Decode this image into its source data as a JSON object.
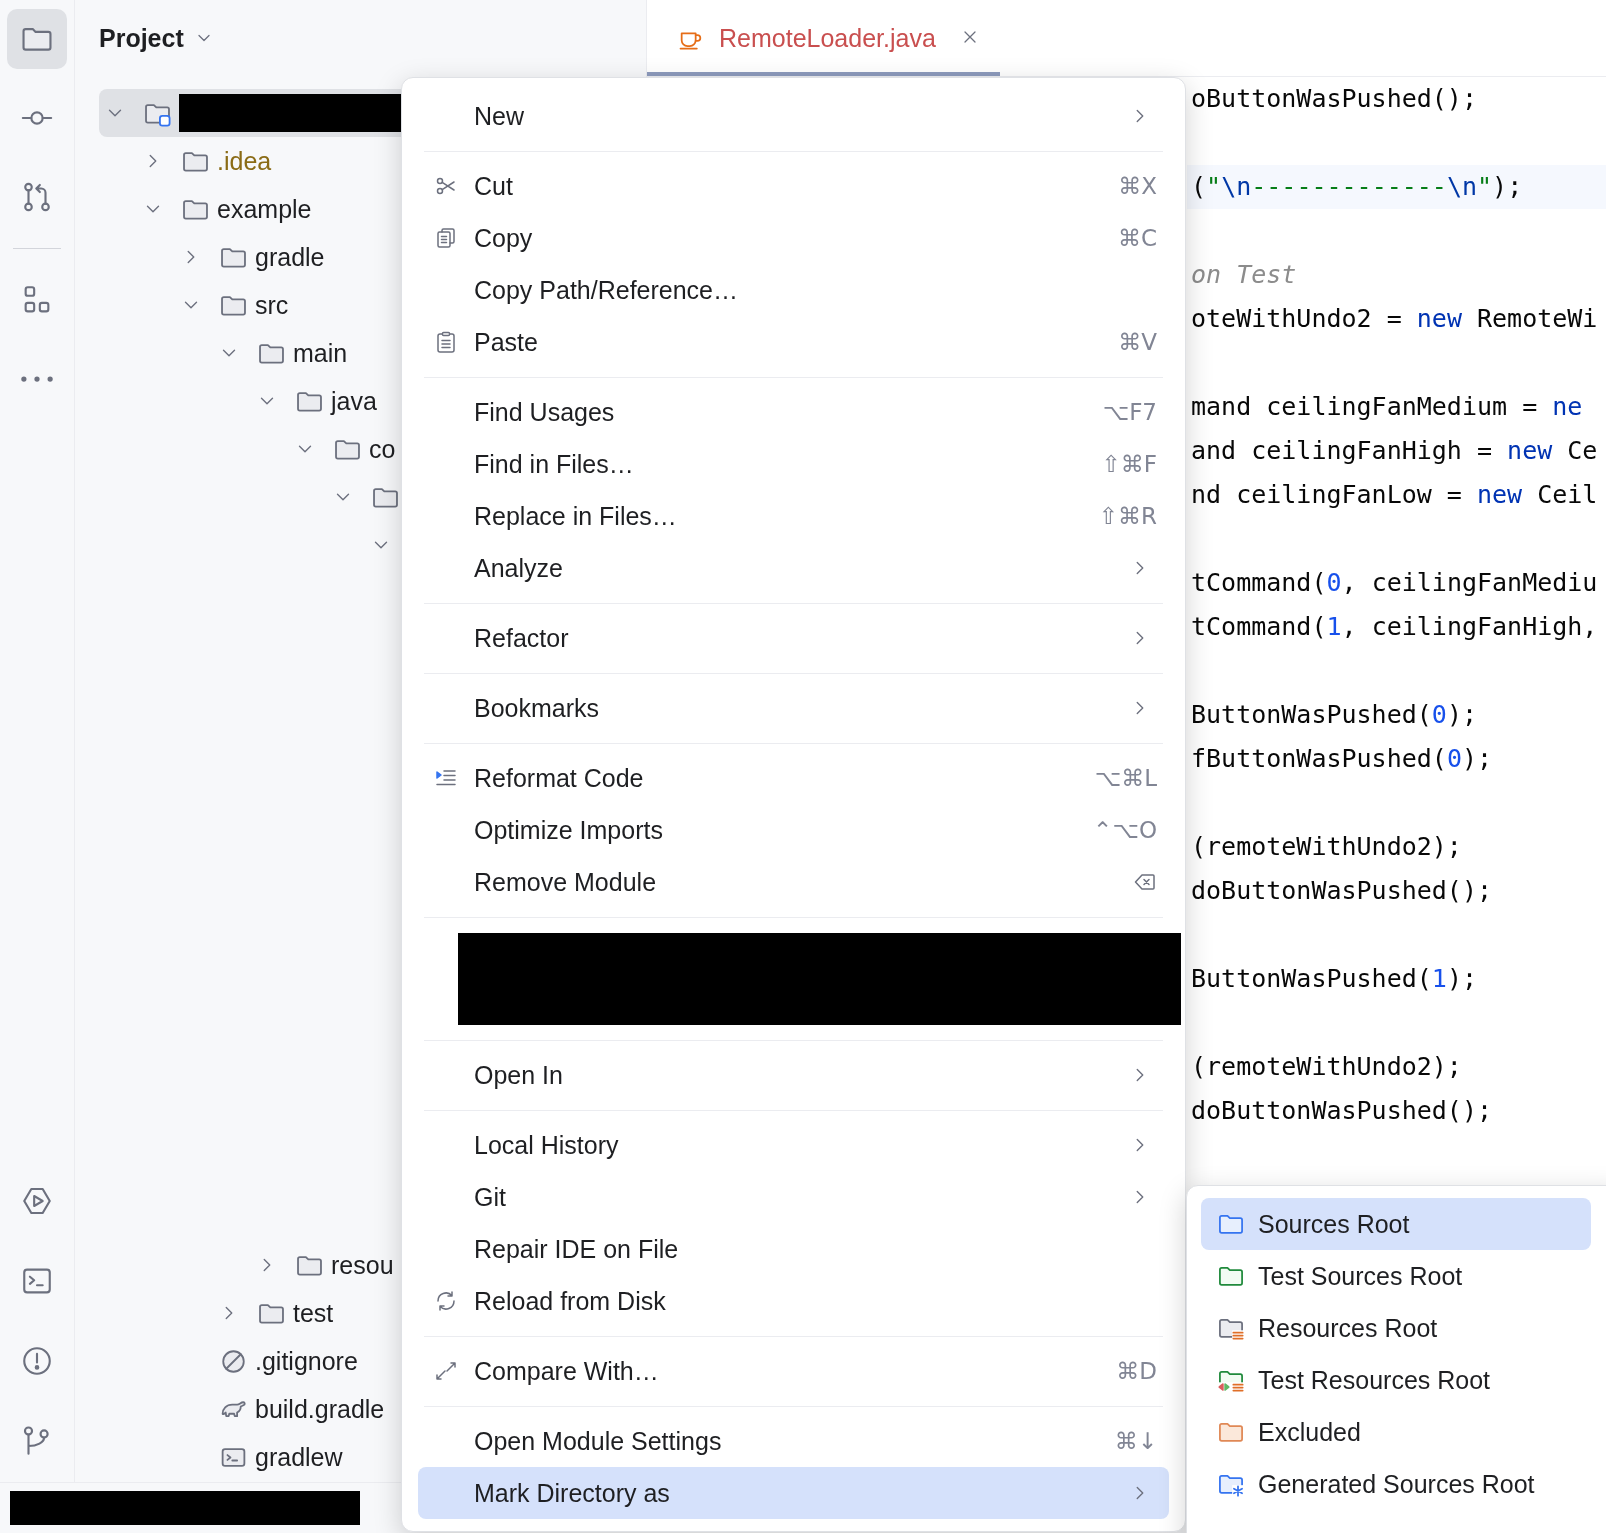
{
  "tool_strip": {
    "top": [
      {
        "kind": "folder",
        "selected": true
      },
      {
        "kind": "commit",
        "selected": false
      },
      {
        "kind": "pull_request",
        "selected": false
      },
      {
        "kind": "separator"
      },
      {
        "kind": "structure",
        "selected": false
      },
      {
        "kind": "more",
        "selected": false
      }
    ],
    "bottom": [
      {
        "kind": "run",
        "selected": false
      },
      {
        "kind": "terminal",
        "selected": false
      },
      {
        "kind": "problems",
        "selected": false
      },
      {
        "kind": "branch",
        "selected": false
      }
    ]
  },
  "project_panel": {
    "title": "Project",
    "tree": [
      {
        "redacted": true,
        "kind": "module",
        "expanded": true,
        "selected": true,
        "children": [
          {
            "label": ".idea",
            "kind": "folder",
            "expanded": false,
            "selected": false,
            "ignored": true
          },
          {
            "label": "example",
            "kind": "folder",
            "expanded": true,
            "selected": false,
            "ignored": false,
            "children": [
              {
                "label": "gradle",
                "kind": "folder",
                "expanded": false,
                "selected": false,
                "ignored": false
              },
              {
                "label": "src",
                "kind": "folder",
                "expanded": true,
                "selected": false,
                "ignored": false,
                "children": [
                  {
                    "label": "main",
                    "kind": "folder",
                    "expanded": true,
                    "selected": false,
                    "ignored": false,
                    "children": [
                      {
                        "label": "java",
                        "kind": "folder",
                        "expanded": true,
                        "selected": false,
                        "ignored": false,
                        "children": [
                          {
                            "label": "co",
                            "kind": "folder",
                            "expanded": true,
                            "selected": false,
                            "ignored": false,
                            "children": [
                              {
                                "kind": "folder",
                                "expanded": true,
                                "selected": false,
                                "children": [
                                  {
                                    "expanded": true,
                                    "selected": false
                                  }
                                ]
                              }
                            ]
                          }
                        ]
                      },
                      {
                        "label": "resou",
                        "kind": "folder",
                        "expanded": false,
                        "selected": false,
                        "ignored": false
                      }
                    ]
                  },
                  {
                    "label": "test",
                    "kind": "folder",
                    "expanded": false,
                    "selected": false,
                    "ignored": false
                  }
                ]
              },
              {
                "label": ".gitignore",
                "kind": "gitignore",
                "selected": false,
                "ignored": false
              },
              {
                "label": "build.gradle",
                "kind": "gradle",
                "selected": false,
                "ignored": false
              },
              {
                "label": "gradlew",
                "kind": "script",
                "selected": false,
                "ignored": false
              }
            ]
          }
        ]
      }
    ]
  },
  "editor": {
    "tab": {
      "label": "RemoteLoader.java",
      "selected": true,
      "error": true
    },
    "lines": [
      {
        "kind": "code",
        "current": false,
        "segments": [
          {
            "kind": "plain",
            "text": "oButtonWasPushed();"
          }
        ]
      },
      {
        "kind": "blank"
      },
      {
        "kind": "code",
        "current": true,
        "segments": [
          {
            "kind": "plain",
            "text": "("
          },
          {
            "kind": "string",
            "text": "\""
          },
          {
            "kind": "escape",
            "text": "\\n"
          },
          {
            "kind": "string",
            "text": "-------------"
          },
          {
            "kind": "escape",
            "text": "\\n"
          },
          {
            "kind": "string",
            "text": "\""
          },
          {
            "kind": "plain",
            "text": ");"
          }
        ]
      },
      {
        "kind": "blank"
      },
      {
        "kind": "code",
        "current": false,
        "segments": [
          {
            "kind": "comment",
            "text": "on Test"
          }
        ]
      },
      {
        "kind": "code",
        "current": false,
        "segments": [
          {
            "kind": "plain",
            "text": "oteWithUndo2 = "
          },
          {
            "kind": "keyword",
            "text": "new"
          },
          {
            "kind": "plain",
            "text": " RemoteWi"
          }
        ]
      },
      {
        "kind": "blank"
      },
      {
        "kind": "code",
        "current": false,
        "segments": [
          {
            "kind": "plain",
            "text": "mand ceilingFanMedium = "
          },
          {
            "kind": "keyword",
            "text": "ne"
          }
        ]
      },
      {
        "kind": "code",
        "current": false,
        "segments": [
          {
            "kind": "plain",
            "text": "and ceilingFanHigh = "
          },
          {
            "kind": "keyword",
            "text": "new"
          },
          {
            "kind": "plain",
            "text": " Ce"
          }
        ]
      },
      {
        "kind": "code",
        "current": false,
        "segments": [
          {
            "kind": "plain",
            "text": "nd ceilingFanLow = "
          },
          {
            "kind": "keyword",
            "text": "new"
          },
          {
            "kind": "plain",
            "text": " Ceil"
          }
        ]
      },
      {
        "kind": "blank"
      },
      {
        "kind": "code",
        "current": false,
        "segments": [
          {
            "kind": "plain",
            "text": "tCommand("
          },
          {
            "kind": "number",
            "text": "0"
          },
          {
            "kind": "plain",
            "text": ", ceilingFanMediu"
          }
        ]
      },
      {
        "kind": "code",
        "current": false,
        "segments": [
          {
            "kind": "plain",
            "text": "tCommand("
          },
          {
            "kind": "number",
            "text": "1"
          },
          {
            "kind": "plain",
            "text": ", ceilingFanHigh,"
          }
        ]
      },
      {
        "kind": "blank"
      },
      {
        "kind": "code",
        "current": false,
        "segments": [
          {
            "kind": "plain",
            "text": "ButtonWasPushed("
          },
          {
            "kind": "number",
            "text": "0"
          },
          {
            "kind": "plain",
            "text": ");"
          }
        ]
      },
      {
        "kind": "code",
        "current": false,
        "segments": [
          {
            "kind": "plain",
            "text": "fButtonWasPushed("
          },
          {
            "kind": "number",
            "text": "0"
          },
          {
            "kind": "plain",
            "text": ");"
          }
        ]
      },
      {
        "kind": "blank"
      },
      {
        "kind": "code",
        "current": false,
        "segments": [
          {
            "kind": "plain",
            "text": "(remoteWithUndo2);"
          }
        ]
      },
      {
        "kind": "code",
        "current": false,
        "segments": [
          {
            "kind": "plain",
            "text": "doButtonWasPushed();"
          }
        ]
      },
      {
        "kind": "blank"
      },
      {
        "kind": "code",
        "current": false,
        "segments": [
          {
            "kind": "plain",
            "text": "ButtonWasPushed("
          },
          {
            "kind": "number",
            "text": "1"
          },
          {
            "kind": "plain",
            "text": ");"
          }
        ]
      },
      {
        "kind": "blank"
      },
      {
        "kind": "code",
        "current": false,
        "segments": [
          {
            "kind": "plain",
            "text": "(remoteWithUndo2);"
          }
        ]
      },
      {
        "kind": "code",
        "current": false,
        "segments": [
          {
            "kind": "plain",
            "text": "doButtonWasPushed();"
          }
        ]
      }
    ]
  },
  "context_menu": {
    "items": [
      {
        "kind": "item",
        "label": "New",
        "submenu": true,
        "selected": false
      },
      {
        "kind": "separator"
      },
      {
        "kind": "cut",
        "label": "Cut",
        "shortcut": "⌘X",
        "submenu": false,
        "selected": false
      },
      {
        "kind": "copy",
        "label": "Copy",
        "shortcut": "⌘C",
        "submenu": false,
        "selected": false
      },
      {
        "kind": "item",
        "label": "Copy Path/Reference…",
        "submenu": false,
        "selected": false
      },
      {
        "kind": "paste",
        "label": "Paste",
        "shortcut": "⌘V",
        "submenu": false,
        "selected": false
      },
      {
        "kind": "separator"
      },
      {
        "kind": "item",
        "label": "Find Usages",
        "shortcut": "⌥F7",
        "submenu": false,
        "selected": false
      },
      {
        "kind": "item",
        "label": "Find in Files…",
        "shortcut": "⇧⌘F",
        "submenu": false,
        "selected": false
      },
      {
        "kind": "item",
        "label": "Replace in Files…",
        "shortcut": "⇧⌘R",
        "submenu": false,
        "selected": false
      },
      {
        "kind": "item",
        "label": "Analyze",
        "submenu": true,
        "selected": false
      },
      {
        "kind": "separator"
      },
      {
        "kind": "item",
        "label": "Refactor",
        "submenu": true,
        "selected": false
      },
      {
        "kind": "separator"
      },
      {
        "kind": "item",
        "label": "Bookmarks",
        "submenu": true,
        "selected": false
      },
      {
        "kind": "separator"
      },
      {
        "kind": "reformat",
        "label": "Reformat Code",
        "shortcut": "⌥⌘L",
        "submenu": false,
        "selected": false
      },
      {
        "kind": "item",
        "label": "Optimize Imports",
        "shortcut": "⌃⌥O",
        "submenu": false,
        "selected": false
      },
      {
        "kind": "remove",
        "label": "Remove Module",
        "submenu": false,
        "selected": false
      },
      {
        "kind": "separator"
      },
      {
        "kind": "redacted"
      },
      {
        "kind": "separator"
      },
      {
        "kind": "item",
        "label": "Open In",
        "submenu": true,
        "selected": false
      },
      {
        "kind": "separator"
      },
      {
        "kind": "item",
        "label": "Local History",
        "submenu": true,
        "selected": false
      },
      {
        "kind": "item",
        "label": "Git",
        "submenu": true,
        "selected": false
      },
      {
        "kind": "item",
        "label": "Repair IDE on File",
        "submenu": false,
        "selected": false
      },
      {
        "kind": "reload",
        "label": "Reload from Disk",
        "submenu": false,
        "selected": false
      },
      {
        "kind": "separator"
      },
      {
        "kind": "compare",
        "label": "Compare With…",
        "shortcut": "⌘D",
        "submenu": false,
        "selected": false
      },
      {
        "kind": "separator"
      },
      {
        "kind": "item",
        "label": "Open Module Settings",
        "shortcut": "⌘↓",
        "submenu": false,
        "selected": false
      },
      {
        "kind": "item",
        "label": "Mark Directory as",
        "submenu": true,
        "selected": true
      }
    ]
  },
  "submenu": {
    "items": [
      {
        "kind": "sources",
        "label": "Sources Root",
        "selected": true
      },
      {
        "kind": "test_sources",
        "label": "Test Sources Root",
        "selected": false
      },
      {
        "kind": "resources",
        "label": "Resources Root",
        "selected": false
      },
      {
        "kind": "test_resources",
        "label": "Test Resources Root",
        "selected": false
      },
      {
        "kind": "excluded",
        "label": "Excluded",
        "selected": false
      },
      {
        "kind": "generated",
        "label": "Generated Sources Root",
        "selected": false
      }
    ]
  },
  "status_bar": {
    "redacted": true
  }
}
